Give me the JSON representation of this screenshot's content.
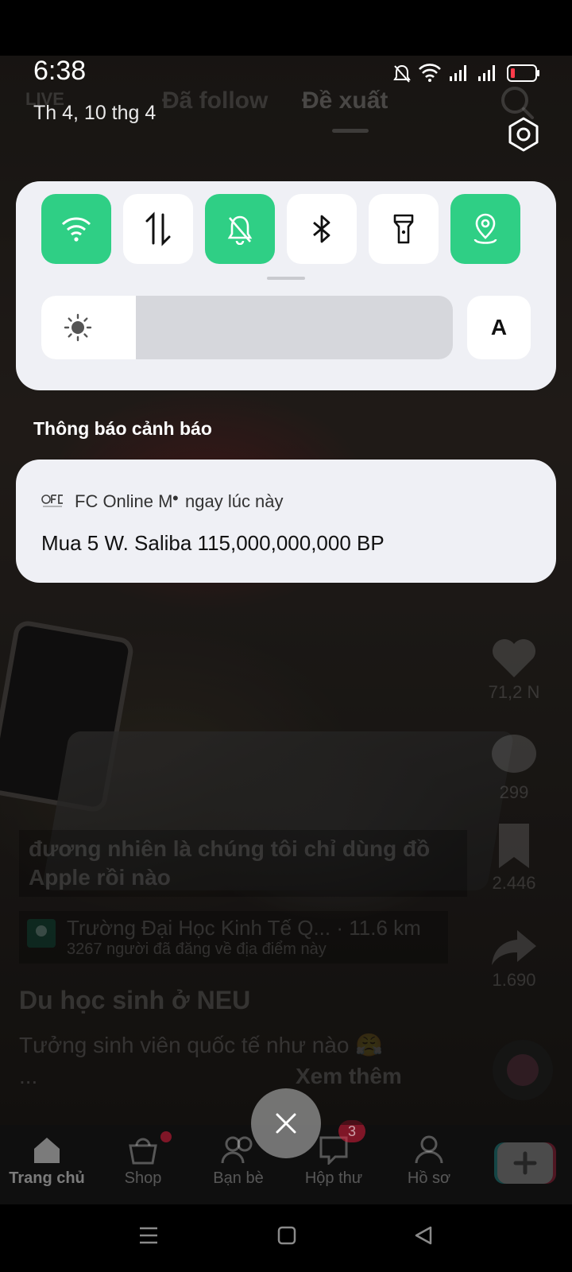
{
  "status_bar": {
    "time": "6:38",
    "date": "Th 4, 10 thg 4",
    "icons": [
      "bell-muted-icon",
      "wifi-icon",
      "signal-icon",
      "signal-icon",
      "battery-low-icon"
    ]
  },
  "background_app": {
    "top_tabs": {
      "live": "LIVE",
      "following": "Đã follow",
      "for_you": "Đề xuất"
    },
    "caption": "đương nhiên là chúng tôi chỉ dùng đồ Apple rồi nào",
    "location": {
      "name": "Trường Đại Học Kinh Tế Q...",
      "distance": "· 11.6 km",
      "subtitle": "3267 người đã đăng về địa điểm này"
    },
    "video_title": "Du học sinh ở NEU",
    "video_desc": "Tưởng sinh viên quốc tế như nào 😤",
    "video_more_prefix": "...",
    "video_more": "Xem thêm",
    "side_actions": {
      "likes": "71,2 N",
      "comments": "299",
      "saves": "2.446",
      "shares": "1.690"
    },
    "bottom_nav": {
      "home": "Trang chủ",
      "shop": "Shop",
      "friends": "Bạn bè",
      "inbox": "Hộp thư",
      "inbox_badge": "3",
      "profile": "Hồ sơ"
    }
  },
  "quick_settings": {
    "tiles": [
      {
        "name": "wifi-icon",
        "active": true
      },
      {
        "name": "mobile-data-icon",
        "active": false
      },
      {
        "name": "bell-muted-icon",
        "active": true
      },
      {
        "name": "bluetooth-icon",
        "active": false
      },
      {
        "name": "flashlight-icon",
        "active": false
      },
      {
        "name": "location-icon",
        "active": true
      }
    ],
    "brightness_level": 0.23,
    "auto_brightness_label": "A",
    "active_color": "#2fcf85"
  },
  "notifications": {
    "section_title": "Thông báo cảnh báo",
    "items": [
      {
        "app_name": "FC Online M",
        "time": "ngay lúc này",
        "body": "Mua 5 W. Saliba 115,000,000,000 BP"
      }
    ]
  }
}
